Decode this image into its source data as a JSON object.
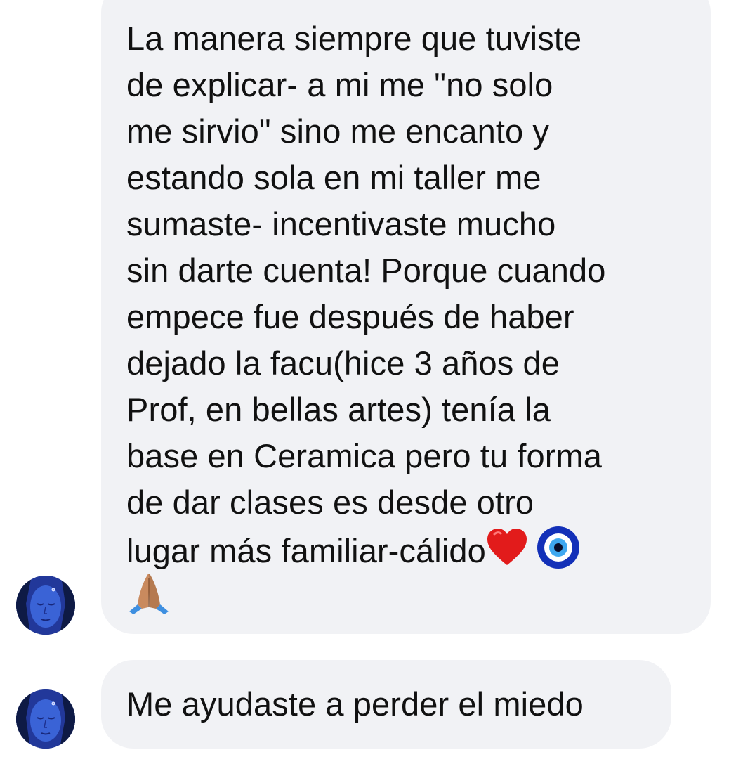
{
  "messages": [
    {
      "lines": [
        "La manera siempre que tuviste",
        "de explicar- a mi me \"no solo",
        "me sirvio\" sino me encanto y",
        "estando sola en mi taller me",
        "sumaste- incentivaste mucho",
        "sin darte cuenta! Porque cuando",
        "empece fue después de haber",
        "dejado la facu(hice 3 años de",
        "Prof, en bellas artes) tenía la",
        "base en Ceramica pero tu forma",
        "de dar clases es desde otro",
        "lugar más familiar-cálido"
      ],
      "emojis": [
        "red-heart-emoji",
        "nazar-amulet-emoji",
        "folded-hands-emoji"
      ]
    },
    {
      "lines": [
        "Me ayudaste a perder el miedo"
      ]
    }
  ],
  "colors": {
    "bubble": "#f1f2f5",
    "text": "#111111",
    "avatar": "#2a47b5"
  }
}
